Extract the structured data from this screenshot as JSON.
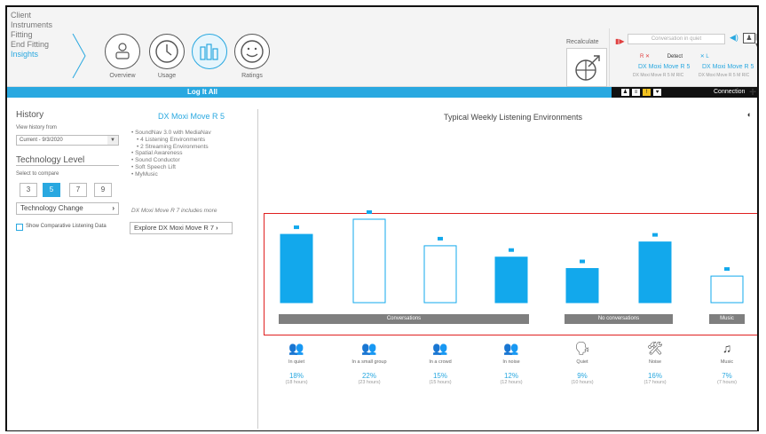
{
  "nav": {
    "items": [
      "Client",
      "Instruments",
      "Fitting",
      "End Fitting",
      "Insights"
    ],
    "active": "Insights"
  },
  "toolbar": {
    "buttons": [
      {
        "label": "Overview",
        "icon": "overview-icon"
      },
      {
        "label": "Usage",
        "icon": "clock-icon"
      },
      {
        "label": "",
        "icon": "bar-chart-icon"
      },
      {
        "label": "Ratings",
        "icon": "smiley-icon"
      }
    ]
  },
  "right_header": {
    "recalculate": "Recalculate",
    "conversation_placeholder": "Conversation in quiet",
    "detect_label": "Detect",
    "left_marker": "R ✕",
    "right_marker": "✕ L",
    "device_right": "DX Moxi Move R 5",
    "device_left": "DX Moxi Move R 5",
    "device_right_sub": "DX Moxi Move R 5 M RIC",
    "device_left_sub": "DX Moxi Move R 5 M RIC",
    "connection": "Connection"
  },
  "log_it_all": "Log It All",
  "history": {
    "title": "History",
    "view_label": "View history from",
    "selected": "Current - 9/3/2020"
  },
  "technology": {
    "title": "Technology Level",
    "select_label": "Select to compare",
    "levels": [
      "3",
      "5",
      "7",
      "9"
    ],
    "selected_level": "5",
    "change_button": "Technology Change",
    "show_comparative": "Show Comparative Listening Data"
  },
  "product": {
    "title": "DX Moxi Move R 5",
    "features": [
      "• SoundNav 3.0 with MediaNav",
      "  • 4 Listening Environments",
      "  • 2 Streaming Environments",
      "• Spatial Awareness",
      "• Sound Conductor",
      "• Soft Speech Lift",
      "• MyMusic"
    ],
    "includes_more": "DX Moxi Move R 7 includes more",
    "explore_button": "Explore DX Moxi Move R 7"
  },
  "chart_data": {
    "type": "bar",
    "title": "Typical Weekly Listening Environments",
    "categories": [
      "In quiet",
      "In a small group",
      "In a crowd",
      "In noise",
      "Quiet",
      "Noise",
      "Music"
    ],
    "values": [
      18,
      22,
      15,
      12,
      9,
      16,
      7
    ],
    "hours": [
      "(18 hours)",
      "(23 hours)",
      "(15 hours)",
      "(12 hours)",
      "(10 hours)",
      "(17 hours)",
      "(7 hours)"
    ],
    "percent_labels": [
      "18%",
      "22%",
      "15%",
      "12%",
      "9%",
      "16%",
      "7%"
    ],
    "filled": [
      true,
      false,
      false,
      true,
      true,
      true,
      false
    ],
    "groups": [
      {
        "label": "Conversations",
        "from": 0,
        "to": 3
      },
      {
        "label": "No conversations",
        "from": 4,
        "to": 5
      },
      {
        "label": "Music",
        "from": 6,
        "to": 6
      }
    ],
    "ylim": [
      0,
      22
    ],
    "colors": {
      "bar": "#12a8ec",
      "outline": "#12a8ec",
      "group": "#7f7f7f"
    }
  }
}
